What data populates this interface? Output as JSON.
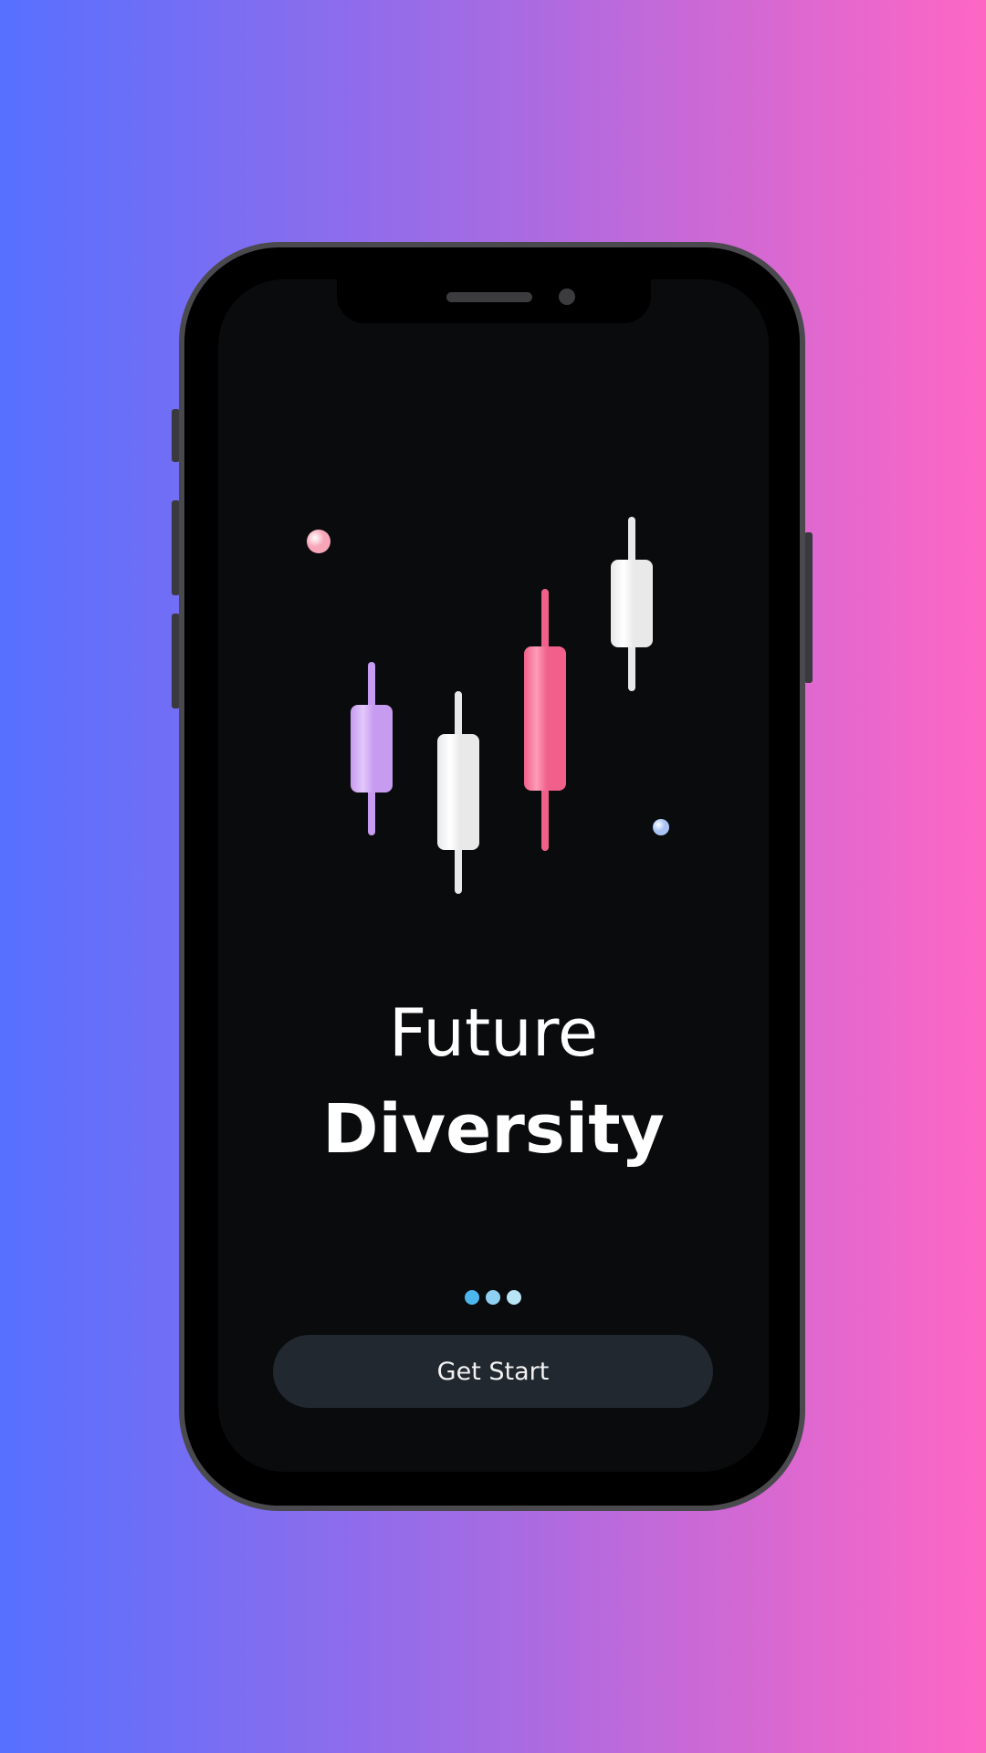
{
  "screen": {
    "title_line1": "Future",
    "title_line2": "Diversity"
  },
  "pager": {
    "pages": 3,
    "dot_colors": [
      "#4db6ee",
      "#8fd0f2",
      "#b9e4f6"
    ]
  },
  "cta": {
    "label": "Get Start"
  },
  "illustration": {
    "candles": [
      {
        "color": "#c79bef",
        "highlight": "#e3c8fb"
      },
      {
        "color": "#e9e9e9",
        "highlight": "#ffffff"
      },
      {
        "color": "#f0608a",
        "highlight": "#ff9bb8"
      },
      {
        "color": "#e9e9e9",
        "highlight": "#ffffff"
      }
    ],
    "orbs": [
      {
        "color": "#f7a6b8"
      },
      {
        "color": "#a9c4f5"
      }
    ]
  },
  "colors": {
    "background_left": "#5670ff",
    "background_right": "#ff66c4",
    "screen": "#090b0d",
    "button": "#222830"
  }
}
